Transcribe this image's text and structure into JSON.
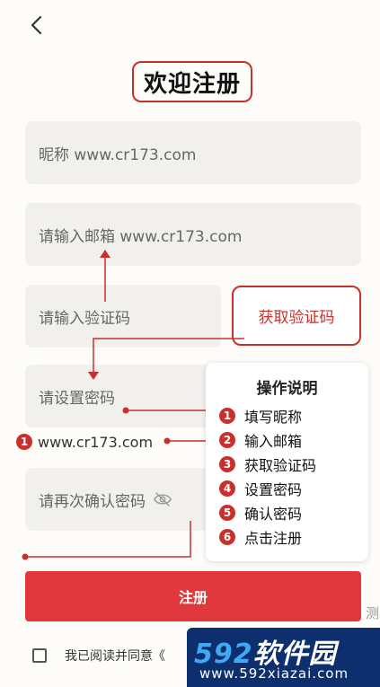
{
  "title": "欢迎注册",
  "fields": {
    "nickname": "昵称  www.cr173.com",
    "email": "请输入邮箱  www.cr173.com",
    "code": "请输入验证码",
    "password": "请设置密码",
    "confirm": "请再次确认密码"
  },
  "get_code_label": "获取验证码",
  "annotation": {
    "num": "1",
    "text": "www.cr173.com"
  },
  "instructions": {
    "title": "操作说明",
    "steps": [
      {
        "num": "1",
        "label": "填写昵称"
      },
      {
        "num": "2",
        "label": "输入邮箱"
      },
      {
        "num": "3",
        "label": "获取验证码"
      },
      {
        "num": "4",
        "label": "设置密码"
      },
      {
        "num": "5",
        "label": "确认密码"
      },
      {
        "num": "6",
        "label": "点击注册"
      }
    ]
  },
  "register_label": "注册",
  "agree_text": "我已阅读并同意《",
  "side_char": "测",
  "watermark": {
    "brand_num": "592",
    "brand_text": "软件园",
    "url": "www.592xiazai.com"
  },
  "colors": {
    "accent": "#c9302c",
    "button": "#e0383c"
  },
  "icons": {
    "back": "chevron-left-icon",
    "eye": "eye-off-icon",
    "checkbox": "checkbox-icon"
  }
}
